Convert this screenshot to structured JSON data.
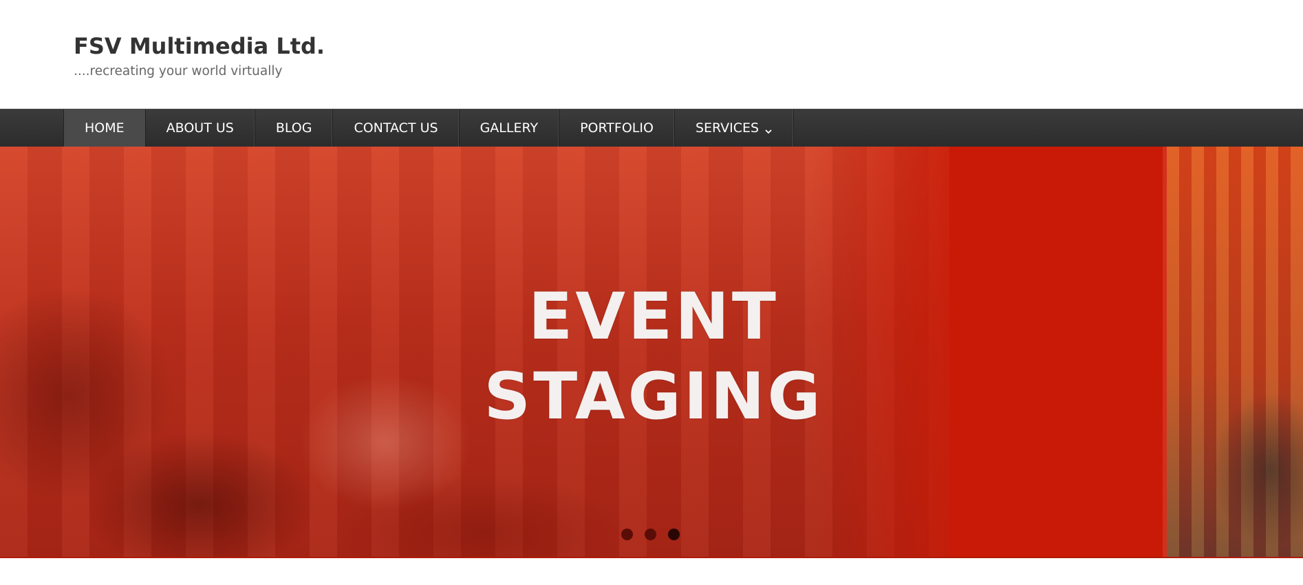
{
  "site": {
    "title": "FSV Multimedia Ltd.",
    "tagline": "....recreating your world virtually"
  },
  "nav": {
    "items": [
      {
        "label": "HOME",
        "active": true
      },
      {
        "label": "ABOUT US"
      },
      {
        "label": "BLOG"
      },
      {
        "label": "CONTACT US"
      },
      {
        "label": "GALLERY"
      },
      {
        "label": "PORTFOLIO"
      },
      {
        "label": "SERVICES",
        "icon": "chevron-down-icon"
      }
    ]
  },
  "hero": {
    "line1": "EVENT",
    "line2": "STAGING",
    "slide_count": 3,
    "active_slide": 3
  },
  "colors": {
    "nav_bg": "#333333",
    "hero_red": "#c81a06",
    "title_text": "#333333",
    "tagline_text": "#666666"
  }
}
